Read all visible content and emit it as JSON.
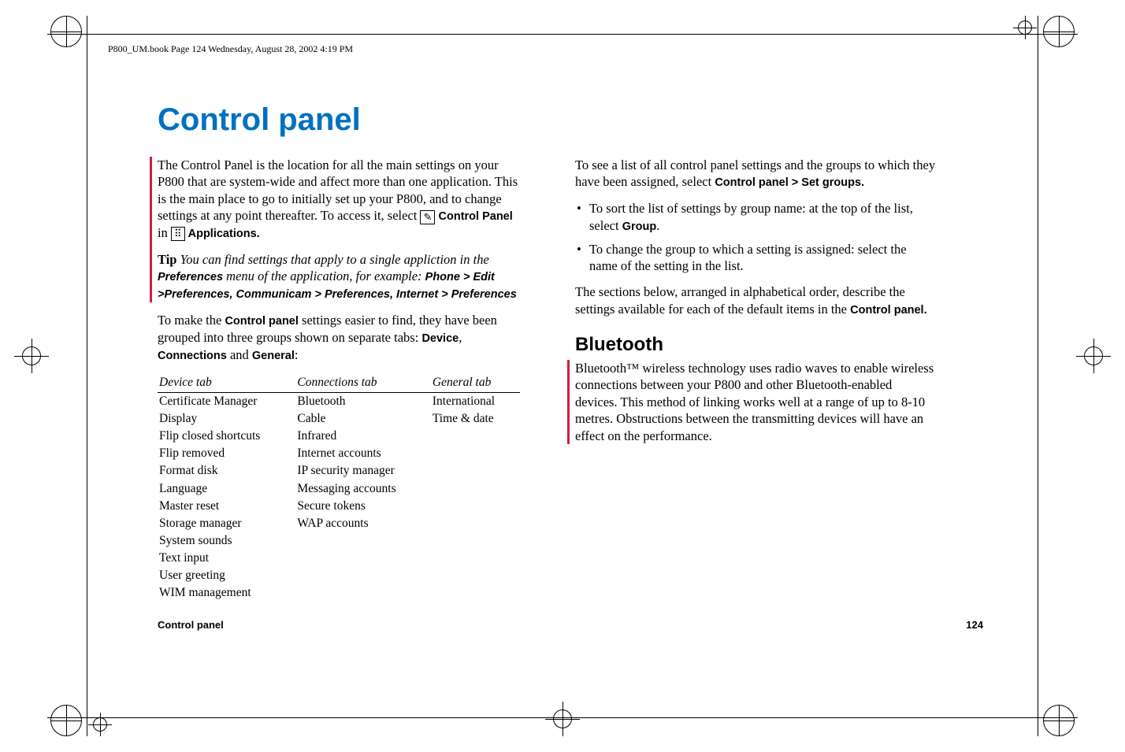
{
  "header_line": "P800_UM.book  Page 124  Wednesday, August 28, 2002  4:19 PM",
  "title": "Control panel",
  "left": {
    "intro_a": "The Control Panel is the location for all the main settings on your P800 that are system-wide and affect more than one application. This is the main place to go to initially set up your P800, and to change settings at any point thereafter. To access it, select ",
    "control_panel_bold": "Control Panel",
    "intro_b": " in ",
    "applications_bold": "Applications.",
    "tip_label": "Tip",
    "tip_a": " You can find settings that apply to a single appliction in the ",
    "tip_prefs": "Preferences",
    "tip_b": " menu of the application, for example: ",
    "tip_paths": "Phone > Edit >Preferences, Communicam > Preferences, Internet > Preferences",
    "groups_a": "To make the ",
    "groups_cp": "Control panel",
    "groups_b": " settings easier to find, they have been grouped into three groups shown on separate tabs: ",
    "tab1": "Device",
    "comma1": ", ",
    "tab2": "Connections",
    "and": " and ",
    "tab3": "General",
    "colon": ":",
    "table": {
      "headers": [
        "Device tab",
        "Connections tab",
        "General tab"
      ],
      "device": [
        "Certificate Manager",
        "Display",
        "Flip closed shortcuts",
        "Flip removed",
        "Format disk",
        "Language",
        "Master reset",
        "Storage manager",
        "System sounds",
        "Text input",
        "User greeting",
        "WIM management"
      ],
      "connections": [
        "Bluetooth",
        "Cable",
        "Infrared",
        "Internet accounts",
        "IP security manager",
        "Messaging accounts",
        "Secure tokens",
        "WAP accounts"
      ],
      "general": [
        "International",
        "Time & date"
      ]
    }
  },
  "right": {
    "p1_a": "To see a list of all control panel settings and the groups to which they have been assigned, select ",
    "p1_b": "Control panel > Set groups.",
    "b1_a": "To sort the list of settings by group name: at the top of the list, select ",
    "b1_b": "Group",
    "b1_c": ".",
    "b2": "To change the group to which a setting is assigned: select the name of the setting in the list.",
    "p2_a": "The sections below, arranged in alphabetical order, describe the settings available for each of the default items in the ",
    "p2_b": "Control panel.",
    "h2": "Bluetooth",
    "bt": "Bluetooth™ wireless technology uses radio waves to enable wireless connections between your P800 and other Bluetooth-enabled devices. This method of linking works well at a range of up to 8-10 metres. Obstructions between the transmitting devices will have an effect on the performance."
  },
  "footer": {
    "left": "Control panel",
    "right": "124"
  },
  "icons": {
    "control_panel": "✎",
    "applications": "⠿"
  }
}
